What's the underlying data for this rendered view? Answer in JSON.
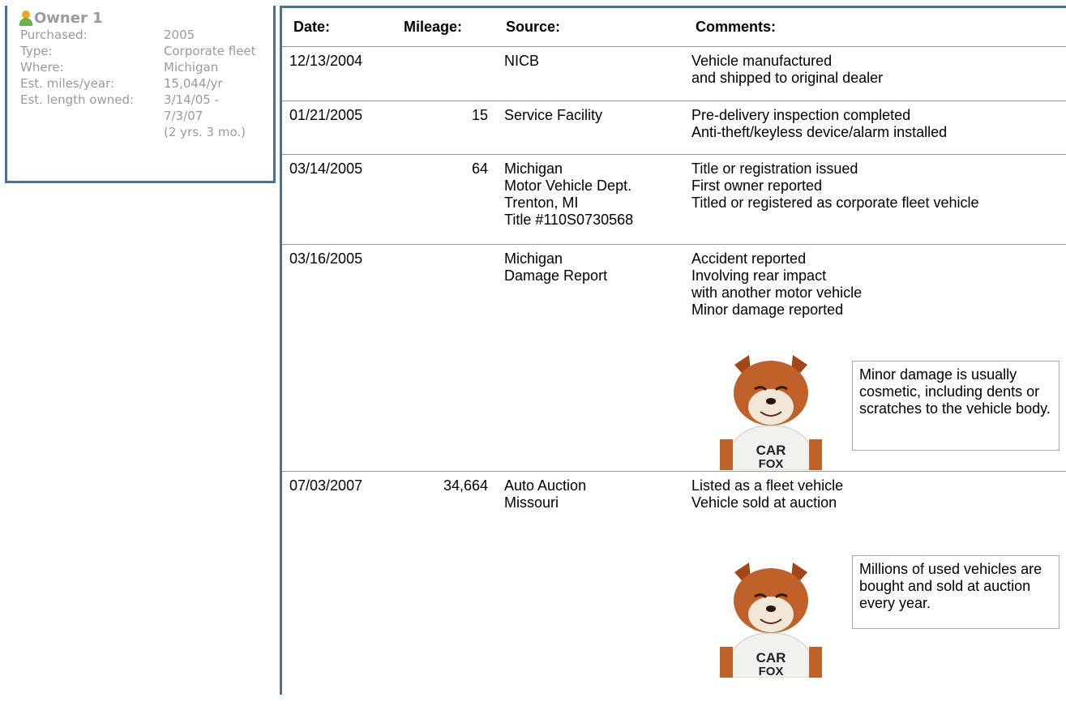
{
  "owner": {
    "title": "Owner 1",
    "rows": [
      {
        "label": "Purchased:",
        "value": "2005"
      },
      {
        "label": "Type:",
        "value": "Corporate fleet"
      },
      {
        "label": "Where:",
        "value": "Michigan"
      },
      {
        "label": "Est. miles/year:",
        "value": "15,044/yr"
      },
      {
        "label": "Est. length owned:",
        "value": "3/14/05 -"
      },
      {
        "label": "",
        "value": "7/3/07"
      },
      {
        "label": "",
        "value": "(2 yrs. 3 mo.)"
      }
    ]
  },
  "table": {
    "headers": {
      "date": "Date:",
      "mileage": "Mileage:",
      "source": "Source:",
      "comments": "Comments:"
    },
    "rows": [
      {
        "date": "12/13/2004",
        "mileage": "",
        "source": [
          "NICB"
        ],
        "comments": [
          "Vehicle manufactured",
          "and shipped to original dealer"
        ]
      },
      {
        "date": "01/21/2005",
        "mileage": "15",
        "source": [
          "Service Facility"
        ],
        "comments": [
          "Pre-delivery inspection completed",
          "Anti-theft/keyless device/alarm installed"
        ]
      },
      {
        "date": "03/14/2005",
        "mileage": "64",
        "source": [
          "Michigan",
          "Motor Vehicle Dept.",
          "Trenton, MI",
          "Title #110S0730568"
        ],
        "comments": [
          "Title or registration issued",
          "First owner reported",
          "Titled or registered as corporate fleet vehicle"
        ]
      },
      {
        "date": "03/16/2005",
        "mileage": "",
        "source": [
          "Michigan",
          "Damage Report"
        ],
        "comments": [
          "Accident reported",
          "Involving rear impact",
          "with another motor vehicle",
          "Minor damage reported"
        ],
        "tip": "Minor damage is usually cosmetic, including dents or scratches to the vehicle body."
      },
      {
        "date": "07/03/2007",
        "mileage": "34,664",
        "source": [
          "Auto Auction",
          "Missouri"
        ],
        "comments": [
          "Listed as a fleet vehicle",
          "Vehicle sold at auction"
        ],
        "tip": "Millions of used vehicles are bought and sold at auction every year."
      }
    ]
  },
  "mascot": {
    "shirt_line1": "CAR",
    "shirt_line2": "FOX"
  }
}
